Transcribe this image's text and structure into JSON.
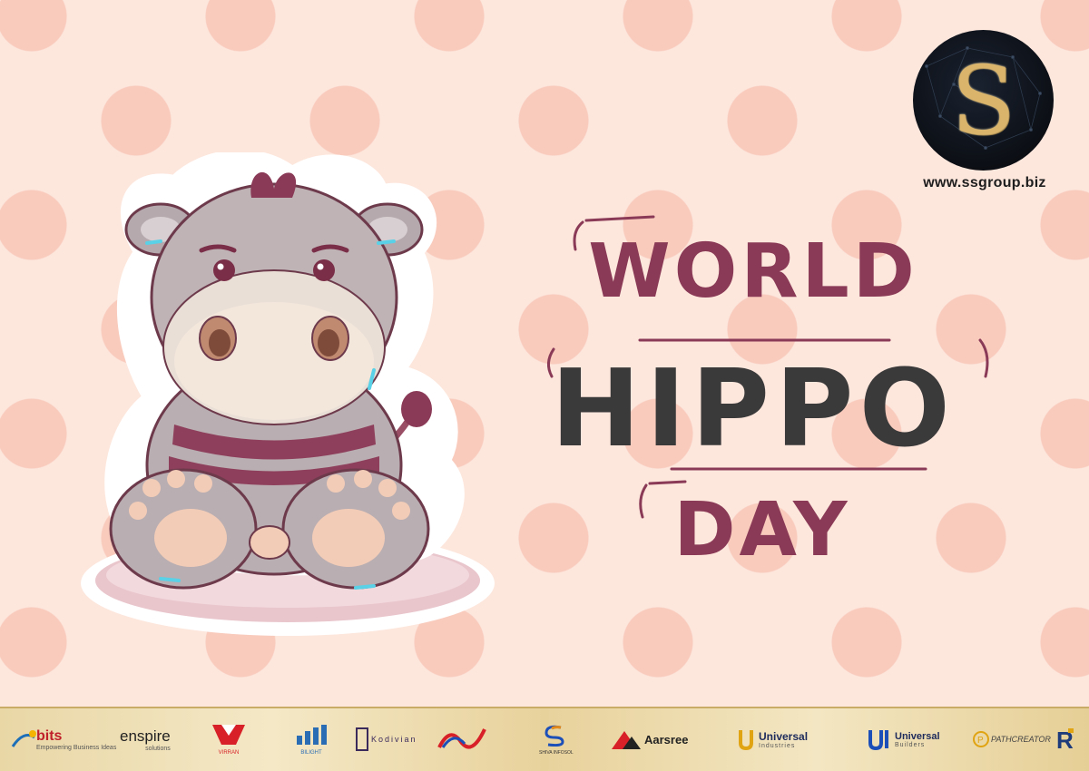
{
  "brand": {
    "logo_letter": "S",
    "website": "www.ssgroup.biz",
    "logo_gold": "#d9b46a"
  },
  "title": {
    "line1": "WORLD",
    "line2": "HIPPO",
    "line3": "DAY",
    "accent_color": "#8a3a56",
    "dark_color": "#3b3a3b"
  },
  "illustration": {
    "subject": "cartoon hippo sticker"
  },
  "sponsors": [
    {
      "name": "bits",
      "tagline": "Empowering Business Ideas"
    },
    {
      "name": "enspire",
      "tagline": "solutions"
    },
    {
      "name": "VIRRAN"
    },
    {
      "name": "BILIGHT"
    },
    {
      "name": "Kodivian"
    },
    {
      "name": "NJ logo"
    },
    {
      "name": "SHIVA INFOSOL"
    },
    {
      "name": "Aarsree"
    },
    {
      "name": "Universal",
      "tagline": "Industries"
    },
    {
      "name": "Universal",
      "tagline": "Builders"
    },
    {
      "name": "PATHCREATOR"
    },
    {
      "name": "R logo"
    }
  ]
}
